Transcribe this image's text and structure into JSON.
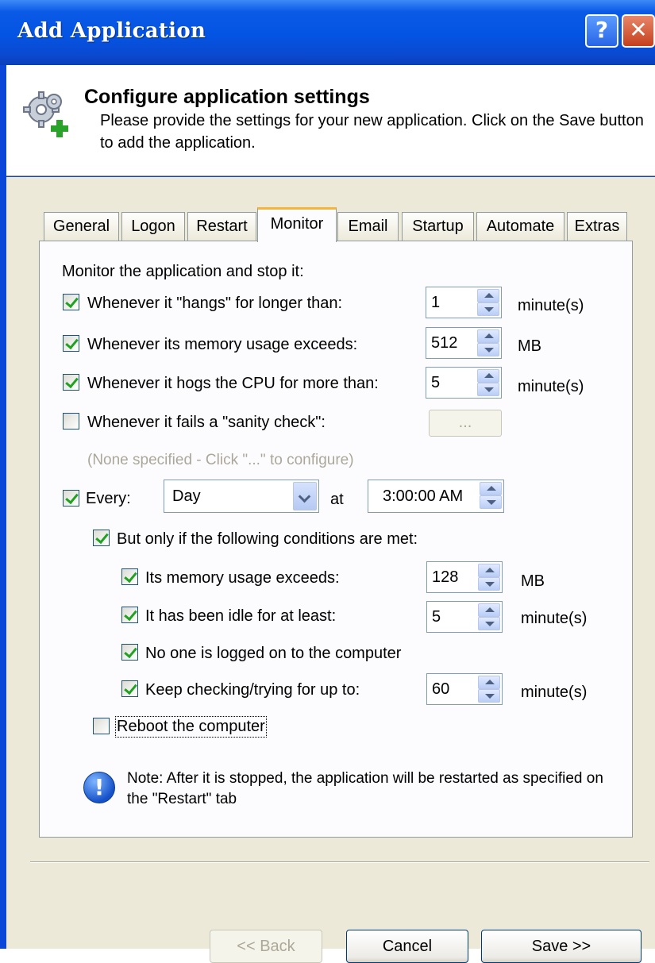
{
  "window": {
    "title": "Add Application",
    "help_glyph": "?",
    "close_glyph": "✕"
  },
  "header": {
    "title": "Configure application settings",
    "description": "Please provide the settings for your new application. Click on the Save button to add the application."
  },
  "tabs": [
    {
      "label": "General"
    },
    {
      "label": "Logon"
    },
    {
      "label": "Restart"
    },
    {
      "label": "Monitor",
      "active": true
    },
    {
      "label": "Email"
    },
    {
      "label": "Startup"
    },
    {
      "label": "Automate"
    },
    {
      "label": "Extras"
    }
  ],
  "monitor": {
    "intro": "Monitor the application and stop it:",
    "hangs": {
      "checked": true,
      "label": "Whenever it \"hangs\" for longer than:",
      "value": "1",
      "unit": "minute(s)"
    },
    "memory": {
      "checked": true,
      "label": "Whenever its memory usage exceeds:",
      "value": "512",
      "unit": "MB"
    },
    "cpu": {
      "checked": true,
      "label": "Whenever it hogs the CPU for more than:",
      "value": "5",
      "unit": "minute(s)"
    },
    "sanity": {
      "checked": false,
      "label": "Whenever it fails a \"sanity check\":",
      "button_label": "...",
      "hint": "(None specified - Click \"...\" to configure)"
    },
    "every": {
      "checked": true,
      "label": "Every:",
      "period": "Day",
      "at_label": "at",
      "time": "3:00:00 AM"
    },
    "conditions": {
      "checked": true,
      "label": "But only if the following conditions are met:",
      "mem": {
        "checked": true,
        "label": "Its memory usage exceeds:",
        "value": "128",
        "unit": "MB"
      },
      "idle": {
        "checked": true,
        "label": "It has been idle for at least:",
        "value": "5",
        "unit": "minute(s)"
      },
      "nologon": {
        "checked": true,
        "label": "No one is logged on to the computer"
      },
      "keep": {
        "checked": true,
        "label": "Keep checking/trying for up to:",
        "value": "60",
        "unit": "minute(s)"
      }
    },
    "reboot": {
      "checked": false,
      "label": "Reboot the computer"
    },
    "note_icon_glyph": "!",
    "note": "Note: After it is stopped, the application will be restarted as specified on the \"Restart\" tab"
  },
  "buttons": {
    "back": "<< Back",
    "cancel": "Cancel",
    "save": "Save >>"
  },
  "colors": {
    "titlebar": "#0454e3",
    "dialog_bg": "#ece9d8",
    "active_tab_accent": "#f8b33a",
    "checkmark": "#21a121"
  }
}
